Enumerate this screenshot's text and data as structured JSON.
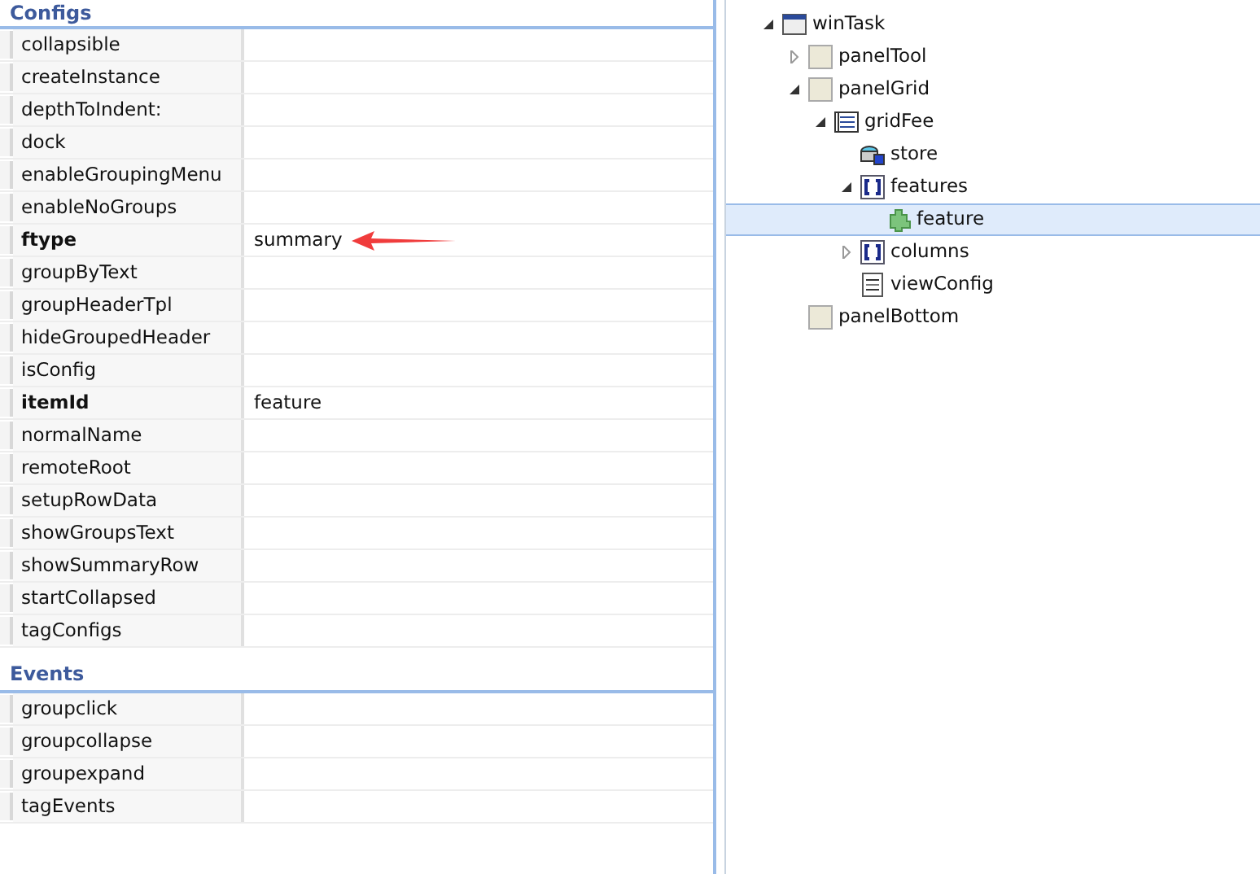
{
  "configs": {
    "title": "Configs",
    "rows": [
      {
        "name": "collapsible",
        "value": "",
        "set": false
      },
      {
        "name": "createInstance",
        "value": "",
        "set": false
      },
      {
        "name": "depthToIndent:",
        "value": "",
        "set": false
      },
      {
        "name": "dock",
        "value": "",
        "set": false
      },
      {
        "name": "enableGroupingMenu",
        "value": "",
        "set": false
      },
      {
        "name": "enableNoGroups",
        "value": "",
        "set": false
      },
      {
        "name": "ftype",
        "value": "summary",
        "set": true,
        "pointer": true
      },
      {
        "name": "groupByText",
        "value": "",
        "set": false
      },
      {
        "name": "groupHeaderTpl",
        "value": "",
        "set": false
      },
      {
        "name": "hideGroupedHeader",
        "value": "",
        "set": false
      },
      {
        "name": "isConfig",
        "value": "",
        "set": false
      },
      {
        "name": "itemId",
        "value": "feature",
        "set": true
      },
      {
        "name": "normalName",
        "value": "",
        "set": false
      },
      {
        "name": "remoteRoot",
        "value": "",
        "set": false
      },
      {
        "name": "setupRowData",
        "value": "",
        "set": false
      },
      {
        "name": "showGroupsText",
        "value": "",
        "set": false
      },
      {
        "name": "showSummaryRow",
        "value": "",
        "set": false
      },
      {
        "name": "startCollapsed",
        "value": "",
        "set": false
      },
      {
        "name": "tagConfigs",
        "value": "",
        "set": false
      }
    ]
  },
  "events": {
    "title": "Events",
    "rows": [
      {
        "name": "groupclick",
        "value": "",
        "set": false
      },
      {
        "name": "groupcollapse",
        "value": "",
        "set": false
      },
      {
        "name": "groupexpand",
        "value": "",
        "set": false
      },
      {
        "name": "tagEvents",
        "value": "",
        "set": false
      }
    ]
  },
  "tree": [
    {
      "label": "winTask",
      "kind": "window",
      "expanded": true,
      "selected": false,
      "children": [
        {
          "label": "panelTool",
          "kind": "panel",
          "expanded": false,
          "selected": false
        },
        {
          "label": "panelGrid",
          "kind": "panel",
          "expanded": true,
          "selected": false,
          "children": [
            {
              "label": "gridFee",
              "kind": "grid",
              "expanded": true,
              "selected": false,
              "children": [
                {
                  "label": "store",
                  "kind": "store",
                  "selected": false
                },
                {
                  "label": "features",
                  "kind": "array",
                  "expanded": true,
                  "selected": false,
                  "children": [
                    {
                      "label": "feature",
                      "kind": "plugin",
                      "selected": true
                    }
                  ]
                },
                {
                  "label": "columns",
                  "kind": "array",
                  "expanded": false,
                  "selected": false
                },
                {
                  "label": "viewConfig",
                  "kind": "config",
                  "selected": false
                }
              ]
            }
          ]
        },
        {
          "label": "panelBottom",
          "kind": "panel",
          "selected": false
        }
      ]
    }
  ]
}
